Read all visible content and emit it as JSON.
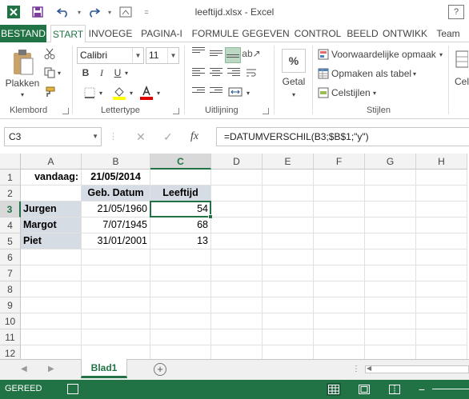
{
  "window": {
    "title": "leeftijd.xlsx - Excel",
    "help": "?"
  },
  "ribbon_tabs": [
    "BESTAND",
    "START",
    "INVOEGE",
    "PAGINA-I",
    "FORMULE",
    "GEGEVEN",
    "CONTROL",
    "BEELD",
    "ONTWIKK",
    "Team"
  ],
  "ribbon": {
    "clipboard": {
      "paste_label": "Plakken",
      "group_label": "Klembord"
    },
    "font": {
      "font_name": "Calibri",
      "font_size": "11",
      "bold": "B",
      "italic": "I",
      "underline": "U",
      "group_label": "Lettertype"
    },
    "alignment": {
      "group_label": "Uitlijning"
    },
    "number": {
      "format_symbol": "%",
      "label": "Getal"
    },
    "styles": {
      "conditional": "Voorwaardelijke opmaak",
      "format_table": "Opmaken als tabel",
      "cell_styles": "Celstijlen",
      "group_label": "Stijlen"
    },
    "cells_label": "Cel"
  },
  "formula_bar": {
    "name_box": "C3",
    "formula": "=DATUMVERSCHIL(B3;$B$1;\"y\")"
  },
  "columns": [
    "A",
    "B",
    "C",
    "D",
    "E",
    "F",
    "G",
    "H"
  ],
  "rows": [
    "1",
    "2",
    "3",
    "4",
    "5",
    "6",
    "7",
    "8",
    "9",
    "10",
    "11",
    "12"
  ],
  "cells": {
    "A1": "vandaag:",
    "B1": "21/05/2014",
    "B2": "Geb. Datum",
    "C2": "Leeftijd",
    "A3": "Jurgen",
    "B3": "21/05/1960",
    "C3": "54",
    "A4": "Margot",
    "B4": "7/07/1945",
    "C4": "68",
    "A5": "Piet",
    "B5": "31/01/2001",
    "C5": "13"
  },
  "selected_cell": "C3",
  "sheets": [
    "Blad1"
  ],
  "status": {
    "ready": "GEREED"
  },
  "colors": {
    "accent": "#217346",
    "header_shade": "#d6dce4"
  }
}
